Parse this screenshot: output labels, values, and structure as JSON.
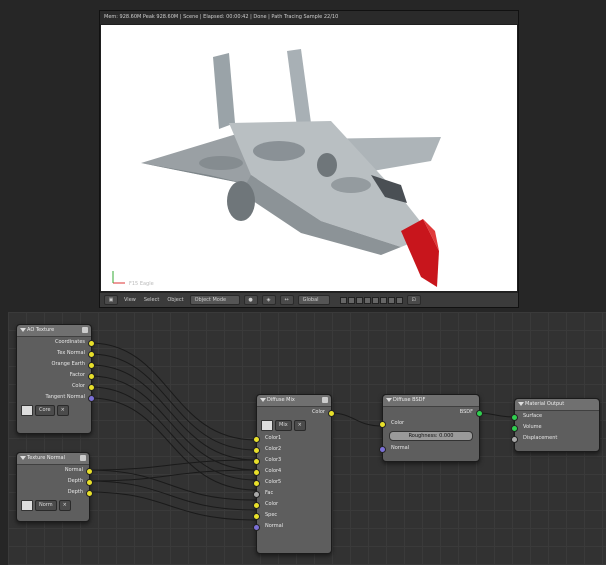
{
  "viewport": {
    "header": "Mem: 928.60M Peak 928.60M | Scene | Elapsed: 00:00:42 | Done | Path Tracing Sample 22/10",
    "corner_label": "F15 Eagle",
    "toolbar": {
      "view": "View",
      "select": "Select",
      "object": "Object",
      "mode": "Object Mode",
      "shading": "Global"
    }
  },
  "nodes": {
    "ao_texture": {
      "title": "AO Texture",
      "outputs": [
        "Coordinates",
        "Tex Normal",
        "Orange Earth",
        "Factor",
        "Color",
        "Tangent Normal"
      ],
      "image_field": "Core"
    },
    "normal_texture": {
      "title": "Texture Normal",
      "outputs": [
        "Normal",
        "Depth",
        "Depth"
      ],
      "image_field": "Norm"
    },
    "mix_shader": {
      "title": "Diffuse Mix",
      "output": "Color",
      "mode": "Mix",
      "inputs": [
        "Color1",
        "Color2",
        "Color3",
        "Color4",
        "Color5",
        "Fac",
        "Color",
        "Spec",
        "Normal"
      ]
    },
    "diffuse": {
      "title": "Diffuse BSDF",
      "output": "BSDF",
      "inputs": [
        "Color",
        "Normal"
      ],
      "roughness_label": "Roughness: 0.000"
    },
    "output": {
      "title": "Material Output",
      "inputs": [
        "Surface",
        "Volume",
        "Displacement"
      ]
    }
  }
}
